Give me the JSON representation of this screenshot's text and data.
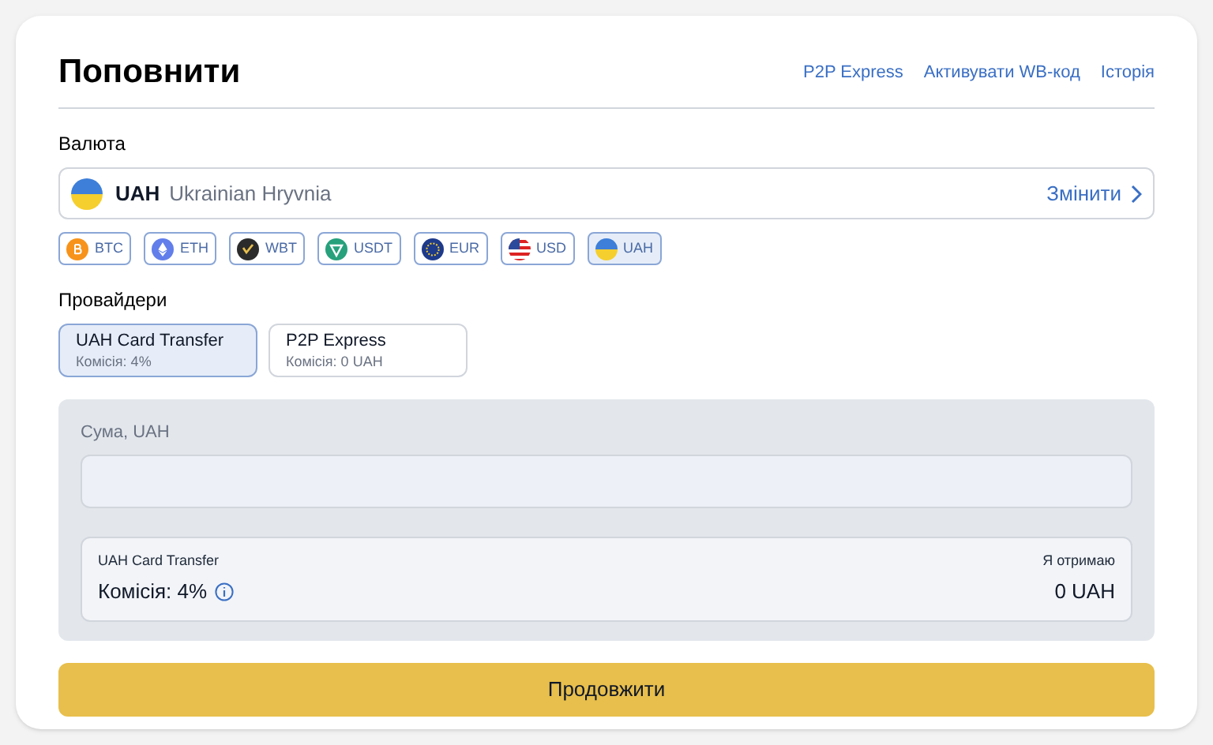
{
  "header": {
    "title": "Поповнити",
    "links": [
      "P2P Express",
      "Активувати WB-код",
      "Історія"
    ]
  },
  "currency": {
    "label": "Валюта",
    "code": "UAH",
    "name": "Ukrainian Hryvnia",
    "change": "Змінити",
    "chips": [
      {
        "kind": "btc",
        "label": "BTC",
        "selected": false
      },
      {
        "kind": "eth",
        "label": "ETH",
        "selected": false
      },
      {
        "kind": "wbt",
        "label": "WBT",
        "selected": false
      },
      {
        "kind": "usdt",
        "label": "USDT",
        "selected": false
      },
      {
        "kind": "eur",
        "label": "EUR",
        "selected": false
      },
      {
        "kind": "usd",
        "label": "USD",
        "selected": false
      },
      {
        "kind": "uah",
        "label": "UAH",
        "selected": true
      }
    ]
  },
  "providers": {
    "label": "Провайдери",
    "items": [
      {
        "name": "UAH Card Transfer",
        "fee": "Комісія: 4%",
        "selected": true
      },
      {
        "name": "P2P Express",
        "fee": "Комісія: 0 UAH",
        "selected": false
      }
    ]
  },
  "amount": {
    "label": "Сума, UAH"
  },
  "summary": {
    "provider": "UAH Card Transfer",
    "fee": "Комісія: 4%",
    "receive_label": "Я отримаю",
    "receive": "0 UAH"
  },
  "submit": "Продовжити"
}
